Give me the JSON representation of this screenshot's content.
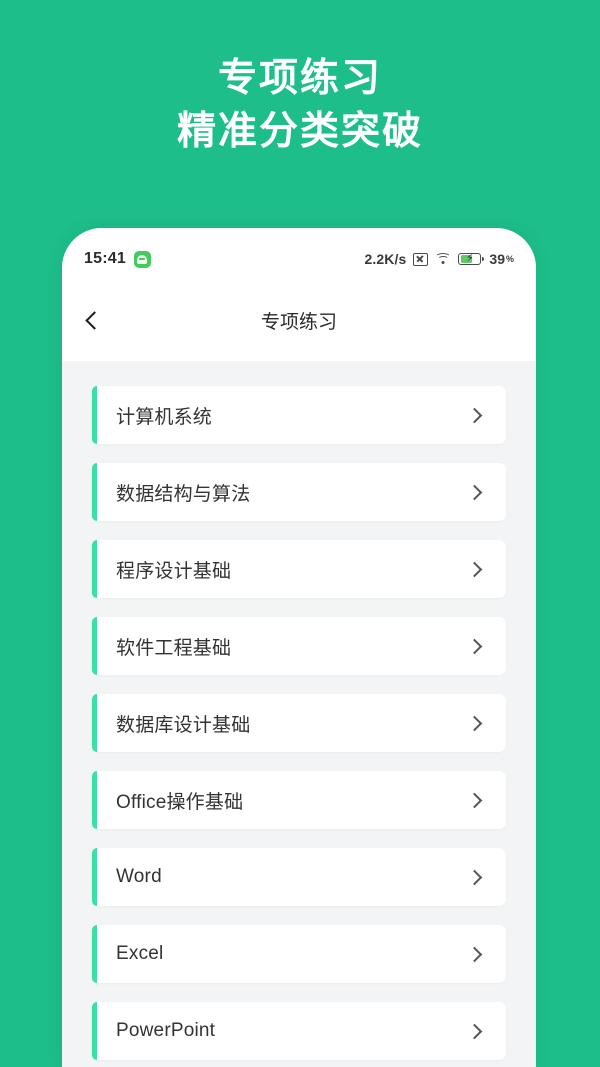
{
  "promo": {
    "background_color": "#1dbe8a",
    "headline_lines": [
      "专项练习",
      "精准分类突破"
    ]
  },
  "phone": {
    "statusbar": {
      "clock": "15:41",
      "app_icon": "android-app-icon",
      "network_speed": "2.2K/s",
      "no_signal_icon": "no-signal-icon",
      "wifi_icon": "wifi-icon",
      "battery_icon": "battery-charging-icon",
      "battery_bolt": "⚡",
      "battery_level": "39",
      "battery_unit": "%"
    },
    "navbar": {
      "back_icon": "chevron-left-icon",
      "title": "专项练习"
    },
    "list": {
      "chevron_icon": "chevron-right-icon",
      "accent_color": "#3ce0a7",
      "items": [
        {
          "label": "计算机系统"
        },
        {
          "label": "数据结构与算法"
        },
        {
          "label": "程序设计基础"
        },
        {
          "label": "软件工程基础"
        },
        {
          "label": "数据库设计基础"
        },
        {
          "label": "Office操作基础"
        },
        {
          "label": "Word"
        },
        {
          "label": "Excel"
        },
        {
          "label": "PowerPoint"
        }
      ]
    }
  }
}
